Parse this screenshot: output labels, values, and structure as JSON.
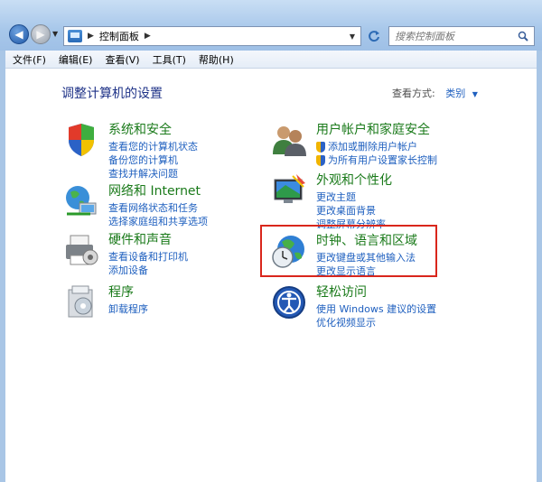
{
  "address": {
    "path_label": "控制面板"
  },
  "search": {
    "placeholder": "搜索控制面板"
  },
  "menu": [
    "文件(F)",
    "编辑(E)",
    "查看(V)",
    "工具(T)",
    "帮助(H)"
  ],
  "page": {
    "title": "调整计算机的设置",
    "viewby_label": "查看方式:",
    "viewby_value": "类别"
  },
  "categories": {
    "system": {
      "title": "系统和安全",
      "links": [
        "查看您的计算机状态",
        "备份您的计算机",
        "查找并解决问题"
      ]
    },
    "network": {
      "title": "网络和 Internet",
      "links": [
        "查看网络状态和任务",
        "选择家庭组和共享选项"
      ]
    },
    "hardware": {
      "title": "硬件和声音",
      "links": [
        "查看设备和打印机",
        "添加设备"
      ]
    },
    "programs": {
      "title": "程序",
      "links": [
        "卸载程序"
      ]
    },
    "users": {
      "title": "用户帐户和家庭安全",
      "links": [
        "添加或删除用户帐户",
        "为所有用户设置家长控制"
      ]
    },
    "appearance": {
      "title": "外观和个性化",
      "links": [
        "更改主题",
        "更改桌面背景",
        "调整屏幕分辨率"
      ]
    },
    "clock": {
      "title": "时钟、语言和区域",
      "links": [
        "更改键盘或其他输入法",
        "更改显示语言"
      ]
    },
    "ease": {
      "title": "轻松访问",
      "links": [
        "使用 Windows 建议的设置",
        "优化视频显示"
      ]
    }
  },
  "colors": {
    "category_title": "#1a7a1a",
    "link": "#1e5fbf",
    "page_title": "#1e3287",
    "highlight": "#d9261c"
  }
}
